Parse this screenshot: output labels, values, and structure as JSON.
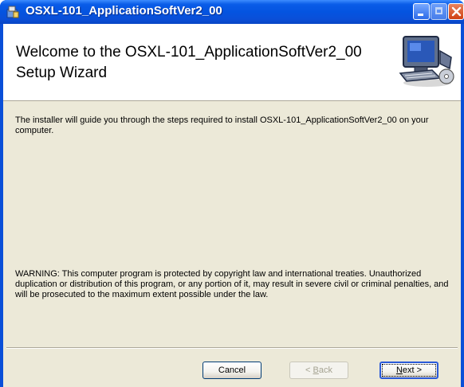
{
  "window": {
    "title": "OSXL-101_ApplicationSoftVer2_00",
    "icons": {
      "app": "installer-icon",
      "minimize": "minimize-icon",
      "maximize": "maximize-icon",
      "close": "close-icon"
    }
  },
  "banner": {
    "title": "Welcome to the OSXL-101_ApplicationSoftVer2_00 Setup Wizard",
    "graphic": "computer-setup-icon"
  },
  "body": {
    "intro": "The installer will guide you through the steps required to install OSXL-101_ApplicationSoftVer2_00 on your computer.",
    "warning": "WARNING: This computer program is protected by copyright law and international treaties. Unauthorized duplication or distribution of this program, or any portion of it, may result in severe civil or criminal penalties, and will be prosecuted to the maximum extent possible under the law."
  },
  "buttons": {
    "cancel": "Cancel",
    "back_prefix": "< ",
    "back_mnemonic": "B",
    "back_rest": "ack",
    "next_mnemonic": "N",
    "next_rest": "ext >"
  },
  "colors": {
    "titlebar": "#0a4fd8",
    "client": "#ece9d8",
    "banner": "#ffffff",
    "close_button": "#cf3f12"
  }
}
